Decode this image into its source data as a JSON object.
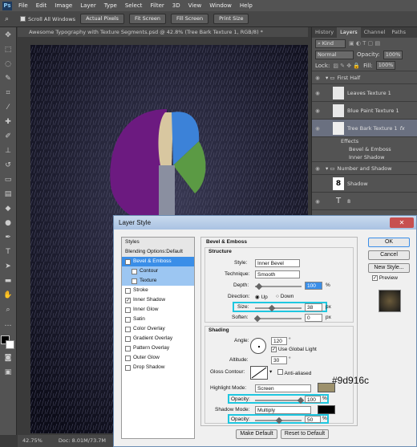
{
  "menubar": {
    "logo": "Ps",
    "items": [
      "File",
      "Edit",
      "Image",
      "Layer",
      "Type",
      "Select",
      "Filter",
      "3D",
      "View",
      "Window",
      "Help"
    ]
  },
  "options": {
    "scroll_all": "Scroll All Windows",
    "actual_pixels": "Actual Pixels",
    "fit_screen": "Fit Screen",
    "fill_screen": "Fill Screen",
    "print_size": "Print Size"
  },
  "document": {
    "tab": "Awesome Typography with Texture Segments.psd @ 42.8% (Tree Bark Texture 1, RGB/8) *",
    "zoom": "42.75%",
    "doc_size": "Doc: 8.01M/73.7M"
  },
  "panel": {
    "tabs": [
      "History",
      "Layers",
      "Channel",
      "Paths"
    ],
    "kind": "Kind",
    "blend": "Normal",
    "opacity_label": "Opacity:",
    "opacity": "100%",
    "lock_label": "Lock:",
    "fill_label": "Fill:",
    "fill": "100%",
    "layers": [
      {
        "name": "First Half",
        "group": true
      },
      {
        "name": "Leaves Texture 1"
      },
      {
        "name": "Blue Paint Texture 1"
      },
      {
        "name": "Tree Bark Texture 1",
        "selected": true,
        "fx": "fx"
      },
      {
        "name": "Effects",
        "effect": true
      },
      {
        "name": "Bevel & Emboss",
        "effect": true
      },
      {
        "name": "Inner Shadow",
        "effect": true
      },
      {
        "name": "Number and Shadow",
        "group": true
      },
      {
        "name": "Shadow",
        "thumb": "8"
      },
      {
        "name": "8",
        "text": "T"
      }
    ]
  },
  "dialog": {
    "title": "Layer Style",
    "styles_header": "Styles",
    "blending": "Blending Options:Default",
    "styles": [
      {
        "label": "Bevel & Emboss",
        "checked": true,
        "active": true
      },
      {
        "label": "Contour",
        "sub": true
      },
      {
        "label": "Texture",
        "sub": true
      },
      {
        "label": "Stroke"
      },
      {
        "label": "Inner Shadow",
        "checked": true
      },
      {
        "label": "Inner Glow"
      },
      {
        "label": "Satin"
      },
      {
        "label": "Color Overlay"
      },
      {
        "label": "Gradient Overlay"
      },
      {
        "label": "Pattern Overlay"
      },
      {
        "label": "Outer Glow"
      },
      {
        "label": "Drop Shadow"
      }
    ],
    "section": "Bevel & Emboss",
    "structure": "Structure",
    "style_label": "Style:",
    "style_value": "Inner Bevel",
    "technique_label": "Technique:",
    "technique_value": "Smooth",
    "depth_label": "Depth:",
    "depth_value": "100",
    "pct": "%",
    "direction_label": "Direction:",
    "up": "Up",
    "down": "Down",
    "size_label": "Size:",
    "size_value": "38",
    "px": "px",
    "soften_label": "Soften:",
    "soften_value": "0",
    "shading": "Shading",
    "angle_label": "Angle:",
    "angle_value": "120",
    "deg": "°",
    "global_light": "Use Global Light",
    "altitude_label": "Altitude:",
    "altitude_value": "30",
    "gloss_label": "Gloss Contour:",
    "anti_aliased": "Anti-aliased",
    "highlight_label": "Highlight Mode:",
    "highlight_value": "Screen",
    "highlight_color": "#9d916c",
    "hl_opacity_label": "Opacity:",
    "hl_opacity": "100",
    "shadow_label": "Shadow Mode:",
    "shadow_value": "Multiply",
    "shadow_color": "#000000",
    "sh_opacity_label": "Opacity:",
    "sh_opacity": "50",
    "make_default": "Make Default",
    "reset_default": "Reset to Default",
    "ok": "OK",
    "cancel": "Cancel",
    "new_style": "New Style...",
    "preview": "Preview",
    "annotation": "#9d916c"
  }
}
